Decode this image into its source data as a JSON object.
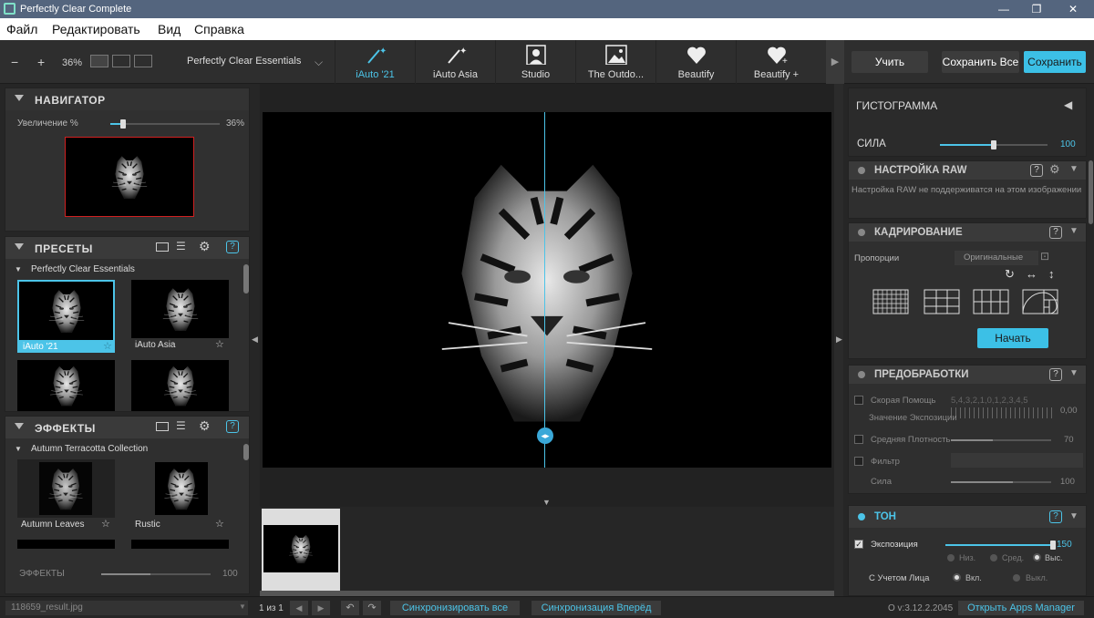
{
  "app": {
    "title": "Perfectly Clear Complete"
  },
  "menu": [
    "Файл",
    "Редактировать",
    "Вид",
    "Справка"
  ],
  "toolbar": {
    "minus": "−",
    "plus": "+",
    "zoom": "36%",
    "preset_select": "Perfectly Clear Essentials",
    "tabs": [
      {
        "label": "iAuto '21",
        "icon": "magic-wand-icon"
      },
      {
        "label": "iAuto Asia",
        "icon": "magic-wand-icon"
      },
      {
        "label": "Studio",
        "icon": "portrait-icon"
      },
      {
        "label": "The Outdo...",
        "icon": "landscape-icon"
      },
      {
        "label": "Beautify",
        "icon": "heart-icon"
      },
      {
        "label": "Beautify +",
        "icon": "heart-plus-icon"
      }
    ],
    "learn": "Учить",
    "save_all": "Сохранить Все",
    "save": "Сохранить"
  },
  "navigator": {
    "title": "НАВИГАТОР",
    "zoom_label": "Увеличение %",
    "zoom_value": "36%",
    "zoom_fraction": 0.12
  },
  "presets": {
    "title": "ПРЕСЕТЫ",
    "group": "Perfectly Clear Essentials",
    "items": [
      {
        "label": "iAuto '21",
        "selected": true
      },
      {
        "label": "iAuto Asia",
        "selected": false
      }
    ]
  },
  "effects": {
    "title": "ЭФФЕКТЫ",
    "group": "Autumn Terracotta Collection",
    "items": [
      {
        "label": "Autumn Leaves"
      },
      {
        "label": "Rustic"
      }
    ],
    "strength_label": "ЭФФЕКТЫ",
    "strength_value": "100",
    "strength_fraction": 0.45
  },
  "right": {
    "histogram": "ГИСТОГРАММА",
    "strength_label": "СИЛА",
    "strength_value": "100",
    "strength_fraction": 0.5,
    "raw": {
      "title": "НАСТРОЙКА RAW",
      "message": "Настройка RAW не поддерживатся на этом изображении"
    },
    "crop": {
      "title": "КАДРИРОВАНИЕ",
      "ratio_label": "Пропорции",
      "ratio_value": "Оригинальные",
      "start": "Начать"
    },
    "pre": {
      "title": "ПРЕДОБРАБОТКИ",
      "quick_help": "Скорая Помощь",
      "scale": "5,4,3,2,1,0,1,2,3,4,5",
      "exposure_value_label": "Значение Экспозиции",
      "exposure_value": "0,00",
      "mid_density": "Средняя Плотность",
      "mid_density_value": "70",
      "mid_density_fraction": 0.42,
      "filter": "Фильтр",
      "strength": "Сила",
      "strength_value": "100",
      "strength_fraction": 0.62
    },
    "tone": {
      "title": "ТОН",
      "exposure": "Экспозиция",
      "exposure_value": "150",
      "exposure_fraction": 1.0,
      "low": "Низ.",
      "mid": "Сред.",
      "high": "Выс.",
      "face_aware": "С Учетом Лица",
      "on": "Вкл.",
      "off": "Выкл."
    }
  },
  "status": {
    "filename": "118659_result.jpg",
    "pages": "1 из 1",
    "sync_all": "Синхронизировать все",
    "sync_forward": "Синхронизация Вперёд",
    "version": "O v:3.12.2.2045",
    "apps": "Открыть Apps Manager"
  },
  "colors": {
    "accent": "#4cc4e8",
    "title_bar": "#54657e"
  }
}
